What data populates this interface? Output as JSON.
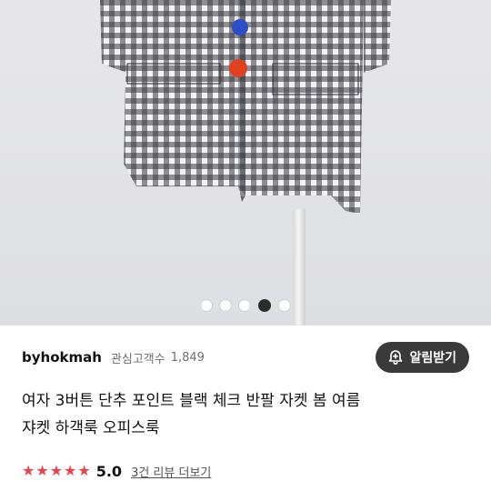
{
  "carousel": {
    "total_images": 5,
    "active_index": 3
  },
  "seller": {
    "name": "byhokmah",
    "follower_label": "관심고객수",
    "follower_count": "1,849",
    "notify_button_label": "알림받기",
    "notify_icon": "bell-plus-icon"
  },
  "product": {
    "title_line1": "여자 3버튼 단추 포인트 블랙 체크 반팔 자켓 봄 여름",
    "title_line2": "쟈켓 하객룩 오피스룩"
  },
  "rating": {
    "stars": 5,
    "score": "5.0",
    "review_link": "3건 리뷰 더보기",
    "star_color": "#e4454f"
  },
  "colors": {
    "button_blue": "#2b4fc9",
    "button_red": "#e2401f",
    "check_dark": "#2b2b33"
  }
}
